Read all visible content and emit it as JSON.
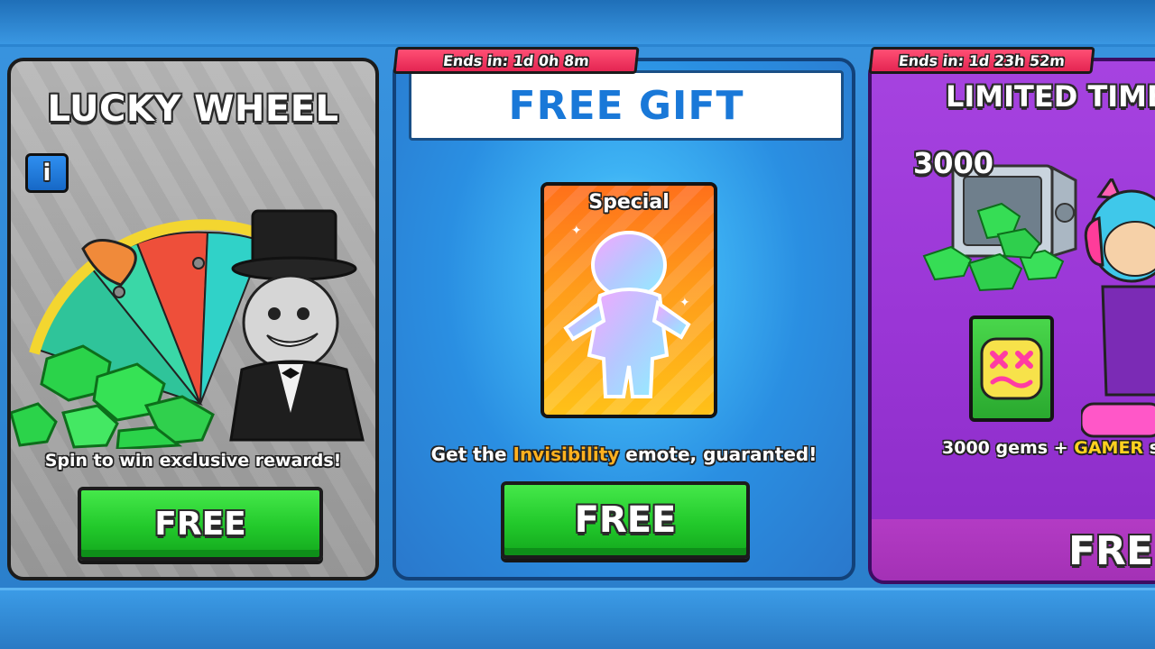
{
  "cards": {
    "lucky_wheel": {
      "title": "LUCKY WHEEL",
      "info_label": "i",
      "description": "Spin to win exclusive rewards!",
      "button_label": "FREE"
    },
    "free_gift": {
      "timer": "Ends in: 1d 0h 8m",
      "title": "FREE GIFT",
      "card_label": "Special",
      "description_prefix": "Get the ",
      "description_highlight": "Invisibility",
      "description_suffix": " emote, guaranted!",
      "button_label": "FREE"
    },
    "limited_time": {
      "timer": "Ends in: 1d 23h 52m",
      "title": "LIMITED TIME",
      "gem_count": "3000",
      "description_prefix": "3000 gems + ",
      "description_highlight": "GAMER",
      "description_suffix": " sk",
      "button_label": "FREE"
    }
  },
  "colors": {
    "background_blue": "#2f88d6",
    "free_button_green": "#22c92b",
    "timer_pink": "#e42552",
    "highlight_orange": "#ffb11f",
    "highlight_yellow": "#ffd21f",
    "limited_purple": "#9a36d6"
  },
  "icons": [
    "info-icon",
    "wheel-pointer-icon",
    "gem-icon",
    "vault-icon",
    "emote-face-icon"
  ]
}
